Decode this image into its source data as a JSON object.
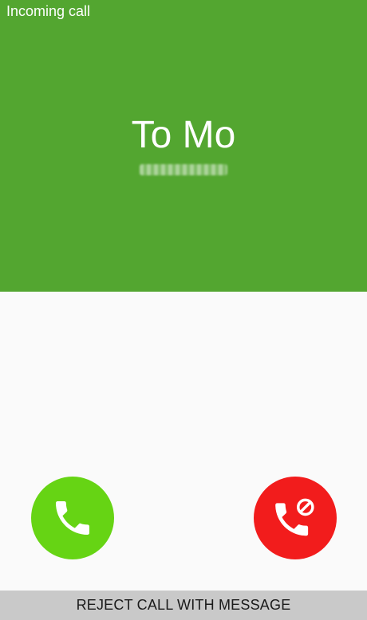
{
  "header": {
    "status_title": "Incoming call",
    "caller_name": "To Mo",
    "background_color": "#53a630"
  },
  "actions": {
    "accept": {
      "icon": "phone-accept-icon",
      "color": "#66d414"
    },
    "reject": {
      "icon": "phone-reject-icon",
      "color": "#f21c1c"
    }
  },
  "footer": {
    "reject_with_message_label": "REJECT CALL WITH MESSAGE",
    "background_color": "#c9c9c9"
  }
}
